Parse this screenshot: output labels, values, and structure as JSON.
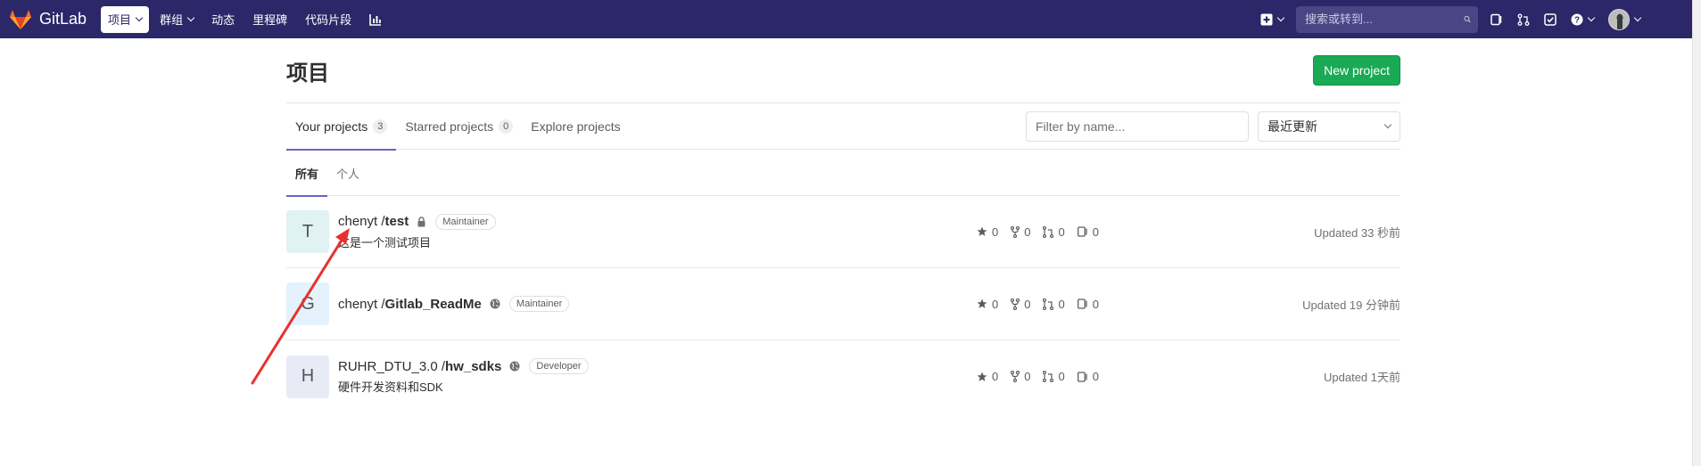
{
  "navbar": {
    "brand": "GitLab",
    "items": [
      {
        "label": "项目",
        "active": true,
        "dropdown": true
      },
      {
        "label": "群组",
        "active": false,
        "dropdown": true
      },
      {
        "label": "动态",
        "active": false,
        "dropdown": false
      },
      {
        "label": "里程碑",
        "active": false,
        "dropdown": false
      },
      {
        "label": "代码片段",
        "active": false,
        "dropdown": false
      }
    ],
    "search_placeholder": "搜索或转到...",
    "icons": [
      "plus-square-icon",
      "search-icon",
      "sidebar-icon",
      "merge-request-icon",
      "todo-check-icon",
      "help-circle-icon",
      "user-avatar"
    ]
  },
  "page": {
    "title": "项目",
    "new_project_label": "New project"
  },
  "tabs": [
    {
      "label": "Your projects",
      "count": "3",
      "active": true
    },
    {
      "label": "Starred projects",
      "count": "0",
      "active": false
    },
    {
      "label": "Explore projects",
      "count": null,
      "active": false
    }
  ],
  "filter": {
    "placeholder": "Filter by name...",
    "sort_value": "最近更新"
  },
  "subtabs": [
    {
      "label": "所有",
      "active": true
    },
    {
      "label": "个人",
      "active": false
    }
  ],
  "projects": [
    {
      "avatar_letter": "T",
      "avatar_color": "#e0f2f1",
      "namespace": "chenyt / ",
      "name": "test",
      "visibility_icon": "lock-icon",
      "role": "Maintainer",
      "description": "这是一个测试项目",
      "stars": "0",
      "forks": "0",
      "merge_requests": "0",
      "issues": "0",
      "updated": "Updated 33 秒前"
    },
    {
      "avatar_letter": "G",
      "avatar_color": "#e3f2fd",
      "namespace": "chenyt / ",
      "name": "Gitlab_ReadMe",
      "visibility_icon": "globe-icon",
      "role": "Maintainer",
      "description": "",
      "stars": "0",
      "forks": "0",
      "merge_requests": "0",
      "issues": "0",
      "updated": "Updated 19 分钟前"
    },
    {
      "avatar_letter": "H",
      "avatar_color": "#e8eaf6",
      "namespace": "RUHR_DTU_3.0 / ",
      "name": "hw_sdks",
      "visibility_icon": "globe-icon",
      "role": "Developer",
      "description": "硬件开发资料和SDK",
      "stars": "0",
      "forks": "0",
      "merge_requests": "0",
      "issues": "0",
      "updated": "Updated 1天前"
    }
  ],
  "colors": {
    "navbar_bg": "#2b2769",
    "accent_underline": "#6666c4",
    "new_project_green": "#1aaa55",
    "annotation_arrow": "#e8312f"
  }
}
